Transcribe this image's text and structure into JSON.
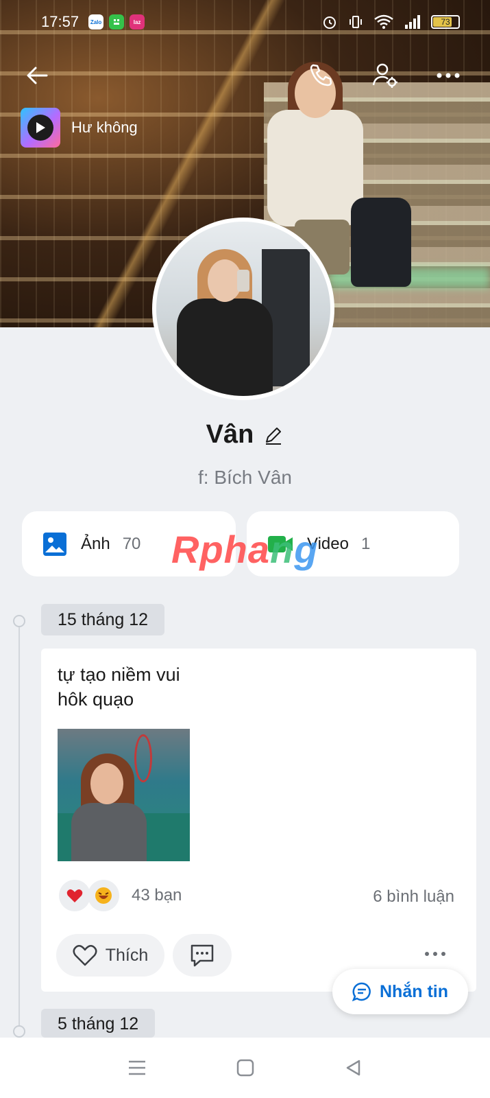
{
  "status_bar": {
    "time": "17:57",
    "apps": [
      {
        "name": "zalo-app-icon",
        "label": "Zalo",
        "color": "#ffffff"
      },
      {
        "name": "green-app-icon",
        "label": "",
        "color": "#35c24a"
      },
      {
        "name": "lazada-app-icon",
        "label": "laz",
        "color": "#e0327a"
      }
    ],
    "battery": "73"
  },
  "music": {
    "title": "Hư không"
  },
  "profile": {
    "name": "Vân",
    "subname": "f: Bích Vân"
  },
  "media": {
    "photos": {
      "label": "Ảnh",
      "count": "70"
    },
    "videos": {
      "label": "Video",
      "count": "1"
    }
  },
  "watermark": {
    "part1": "Rpha",
    "part2": "n",
    "part3": "g"
  },
  "timeline": {
    "posts": [
      {
        "date": "15 tháng 12",
        "text_line1": "tự tạo niềm vui",
        "text_line2": "hôk quạo",
        "reactions_count": "43 bạn",
        "comments_count": "6 bình luận",
        "like_label": "Thích"
      }
    ],
    "next_date": "5 tháng 12"
  },
  "message_button": {
    "label": "Nhắn tin"
  },
  "colors": {
    "accent": "#0a6fd6",
    "background": "#eef0f3"
  }
}
